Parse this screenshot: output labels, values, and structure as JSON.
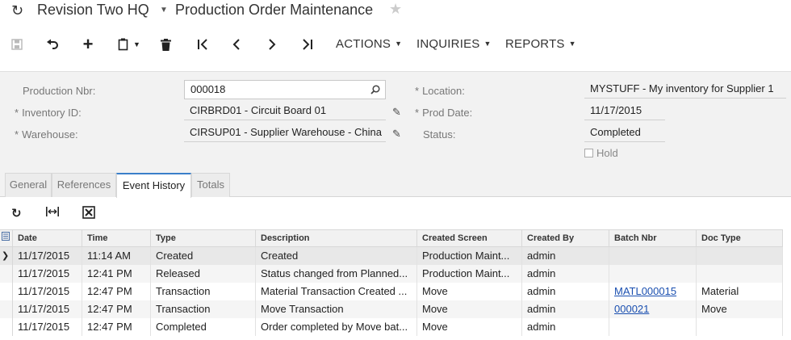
{
  "header": {
    "company": "Revision Two HQ",
    "screen_title": "Production Order Maintenance"
  },
  "toolbar": {
    "menus": [
      "ACTIONS",
      "INQUIRIES",
      "REPORTS"
    ]
  },
  "form": {
    "production_nbr_label": "Production Nbr:",
    "production_nbr_value": "000018",
    "inventory_id_label": "Inventory ID:",
    "inventory_id_value": "CIRBRD01 - Circuit Board 01",
    "warehouse_label": "Warehouse:",
    "warehouse_value": "CIRSUP01 - Supplier Warehouse - China",
    "location_label": "Location:",
    "location_value": "MYSTUFF - My inventory for Supplier 1",
    "prod_date_label": "Prod Date:",
    "prod_date_value": "11/17/2015",
    "status_label": "Status:",
    "status_value": "Completed",
    "hold_label": "Hold",
    "hold_checked": false
  },
  "tabs": [
    "General",
    "References",
    "Event History",
    "Totals"
  ],
  "active_tab": "Event History",
  "grid": {
    "columns": [
      "Date",
      "Time",
      "Type",
      "Description",
      "Created Screen",
      "Created By",
      "Batch Nbr",
      "Doc Type"
    ],
    "rows": [
      [
        "11/17/2015",
        "11:14 AM",
        "Created",
        "Created",
        "Production Maint...",
        "admin",
        "",
        ""
      ],
      [
        "11/17/2015",
        "12:41 PM",
        "Released",
        "Status changed from Planned...",
        "Production Maint...",
        "admin",
        "",
        ""
      ],
      [
        "11/17/2015",
        "12:47 PM",
        "Transaction",
        "Material Transaction Created ...",
        "Move",
        "admin",
        "MATL000015",
        "Material"
      ],
      [
        "11/17/2015",
        "12:47 PM",
        "Transaction",
        "Move Transaction",
        "Move",
        "admin",
        "000021",
        "Move"
      ],
      [
        "11/17/2015",
        "12:47 PM",
        "Completed",
        "Order completed by Move bat...",
        "Move",
        "admin",
        "",
        ""
      ]
    ]
  }
}
